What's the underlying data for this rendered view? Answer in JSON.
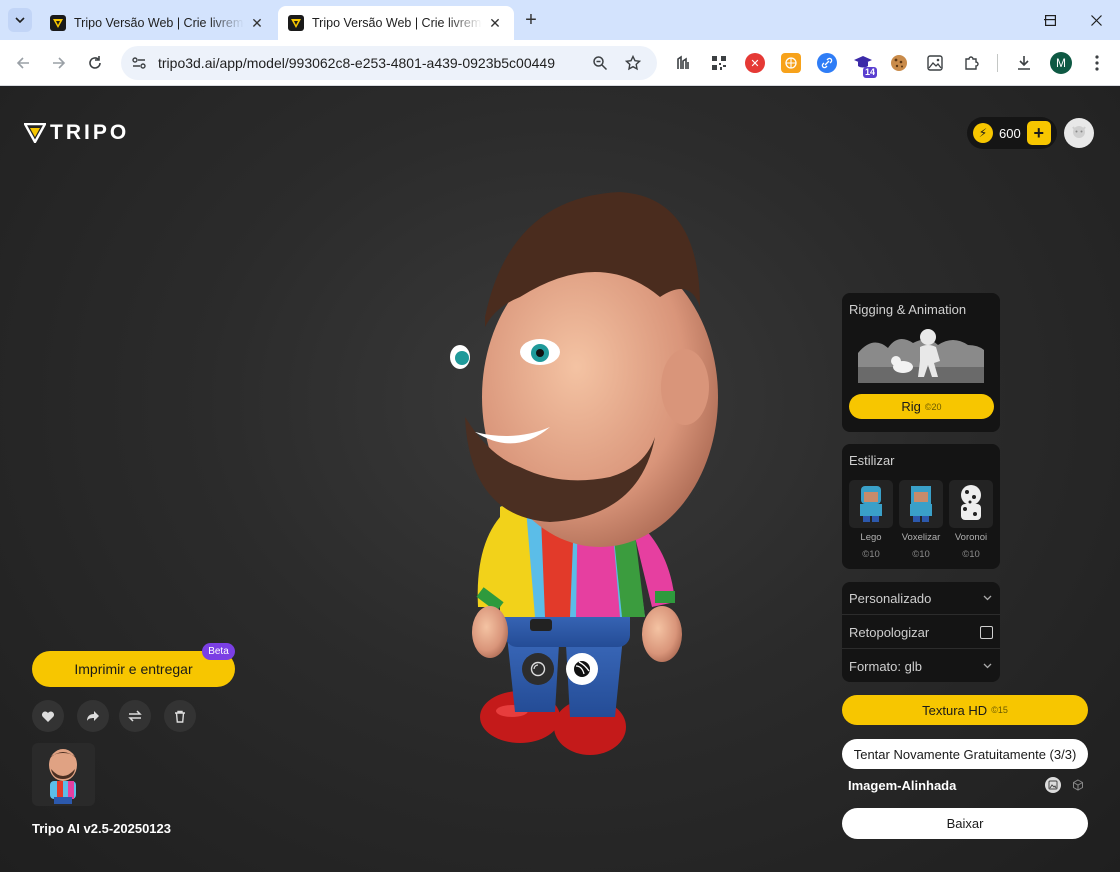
{
  "browser": {
    "tabs": [
      {
        "title": "Tripo Versão Web | Crie livremente",
        "close": "✕"
      },
      {
        "title": "Tripo Versão Web | Crie livremente",
        "close": "✕"
      }
    ],
    "new_tab": "+",
    "url": "tripo3d.ai/app/model/993062c8-e253-4801-a439-0923b5c00449",
    "extension_badge": "14",
    "profile_initial": "M"
  },
  "app": {
    "brand": "TRIPO",
    "credits": "600",
    "credit_symbol": "⚡",
    "add_credit": "+",
    "print_button": "Imprimir e entregar",
    "beta_badge": "Beta",
    "version": "Tripo AI v2.5-20250123",
    "rigging": {
      "title": "Rigging & Animation",
      "button": "Rig",
      "cost": "©20"
    },
    "stylize": {
      "title": "Estilizar",
      "items": [
        {
          "label": "Lego",
          "cost": "©10"
        },
        {
          "label": "Voxelizar",
          "cost": "©10"
        },
        {
          "label": "Voronoi",
          "cost": "©10"
        }
      ]
    },
    "options": {
      "custom": "Personalizado",
      "retopo": "Retopologizar",
      "format": "Formato: glb"
    },
    "hd_texture": {
      "label": "Textura HD",
      "cost": "©15"
    },
    "retry_button": "Tentar Novamente Gratuitamente  (3/3)",
    "aligned_label": "Imagem-Alinhada",
    "download_button": "Baixar"
  },
  "colors": {
    "accent": "#f7c600",
    "beta": "#7b3fe4",
    "app_bg": "#2b2b2b",
    "tab_strip": "#d3e3fd"
  }
}
